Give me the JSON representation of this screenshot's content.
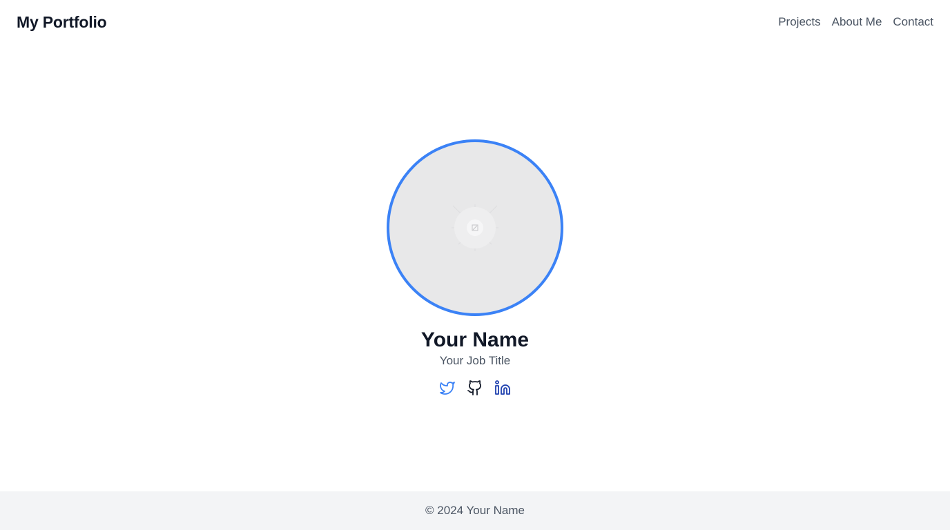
{
  "header": {
    "brand": "My Portfolio",
    "nav": [
      {
        "label": "Projects"
      },
      {
        "label": "About Me"
      },
      {
        "label": "Contact"
      }
    ]
  },
  "profile": {
    "name": "Your Name",
    "job_title": "Your Job Title",
    "avatar_icon": "image-placeholder-icon"
  },
  "socials": [
    {
      "icon": "twitter-icon",
      "color": "#3b82f6"
    },
    {
      "icon": "github-icon",
      "color": "#111827"
    },
    {
      "icon": "linkedin-icon",
      "color": "#1e40af"
    }
  ],
  "footer": {
    "copyright": "© 2024 Your Name"
  },
  "colors": {
    "accent": "#3b82f6",
    "text_primary": "#111827",
    "text_secondary": "#4b5563",
    "footer_bg": "#f3f4f6",
    "avatar_bg": "#e8e8e9"
  }
}
